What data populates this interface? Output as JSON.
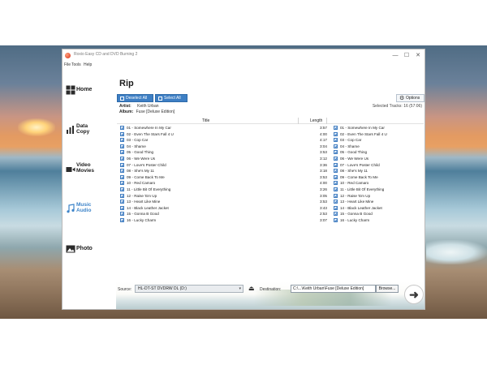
{
  "window": {
    "title": "Roxio Easy CD and DVD Burning 2",
    "controls": {
      "minimize": "—",
      "maximize": "☐",
      "close": "✕"
    }
  },
  "menu": [
    "File",
    "Tools",
    "Help"
  ],
  "sidebar": {
    "items": [
      {
        "label": "Home",
        "icon": "home-grid-icon"
      },
      {
        "label": "Data Copy",
        "icon": "data-chart-icon"
      },
      {
        "label": "Video Movies",
        "icon": "video-camera-icon"
      },
      {
        "label": "Music Audio",
        "icon": "music-note-icon"
      },
      {
        "label": "Photo",
        "icon": "photo-icon"
      }
    ],
    "active": "Music Audio"
  },
  "main": {
    "title": "Rip",
    "toolbar": {
      "deselect_all": "Deselect All",
      "select_all": "Select All",
      "options": "Options"
    },
    "artist_label": "Artist:",
    "artist": "Keith Urban",
    "album_label": "Album:",
    "album": "Fuse [Deluxe Edition]",
    "selected_tracks": "Selected Tracks: 16 (57:06)",
    "columns": {
      "title": "Title",
      "length": "Length"
    }
  },
  "tracks": [
    {
      "title": "01 - Somewhere In My Car",
      "length": "3:57",
      "file": "01 - Somewhere In My Car"
    },
    {
      "title": "02 - Even The Stars Fall 4 U",
      "length": "4:00",
      "file": "02 - Even The Stars Fall 4 U"
    },
    {
      "title": "03 - Cop Car",
      "length": "4:17",
      "file": "03 - Cop Car"
    },
    {
      "title": "04 - Shame",
      "length": "3:04",
      "file": "04 - Shame"
    },
    {
      "title": "05 - Good Thing",
      "length": "3:53",
      "file": "05 - Good Thing"
    },
    {
      "title": "06 - We Were Us",
      "length": "3:12",
      "file": "06 - We Were Us"
    },
    {
      "title": "07 - Love's Poster Child",
      "length": "3:36",
      "file": "07 - Love's Poster Child"
    },
    {
      "title": "08 - She's My 11",
      "length": "3:18",
      "file": "08 - She's My 11"
    },
    {
      "title": "09 - Come Back To Me",
      "length": "3:53",
      "file": "09 - Come Back To Me"
    },
    {
      "title": "10 - Red Camaro",
      "length": "4:00",
      "file": "10 - Red Camaro"
    },
    {
      "title": "11 - Little Bit Of Everything",
      "length": "3:26",
      "file": "11 - Little Bit Of Everything"
    },
    {
      "title": "12 - Raise 'Em Up",
      "length": "3:05",
      "file": "12 - Raise 'Em Up"
    },
    {
      "title": "13 - Heart Like Mine",
      "length": "3:53",
      "file": "13 - Heart Like Mine"
    },
    {
      "title": "14 - Black Leather Jacket",
      "length": "3:43",
      "file": "14 - Black Leather Jacket"
    },
    {
      "title": "15 - Gonna B Good",
      "length": "2:53",
      "file": "15 - Gonna B Good"
    },
    {
      "title": "16 - Lucky Charm",
      "length": "3:07",
      "file": "16 - Lucky Charm"
    }
  ],
  "bottom": {
    "source_label": "Source:",
    "source_value": "HL-DT-ST DVDRW DL (D:)",
    "destination_label": "Destination:",
    "destination_value": "C:\\...\\Keith Urban\\Fuse [Deluxe Edition]",
    "browse": "Browse...",
    "go": "➜"
  },
  "colors": {
    "accent": "#3e7fc4",
    "active_nav": "#3d84c9"
  }
}
